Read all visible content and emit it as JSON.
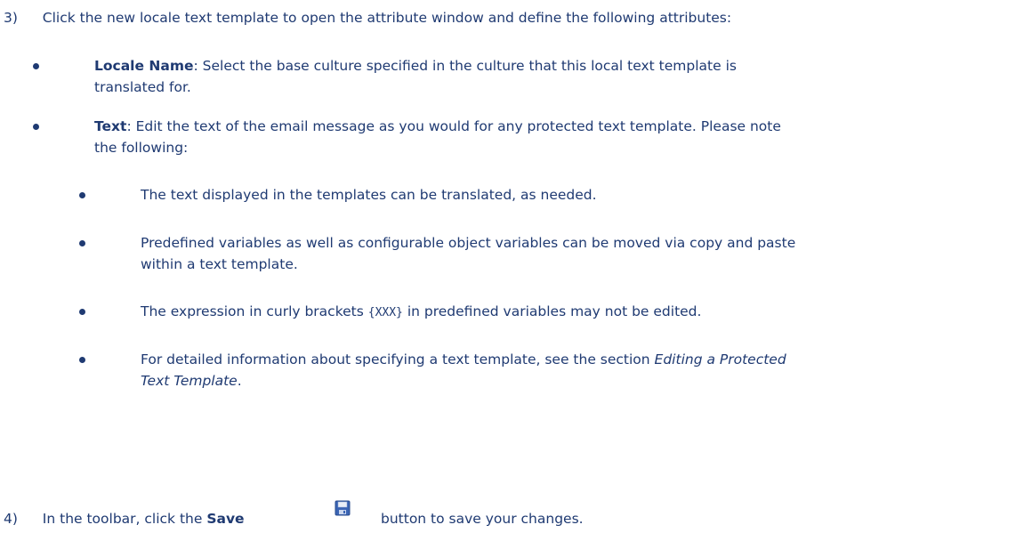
{
  "step3": {
    "number": "3)",
    "text": "Click the new locale text template to open the attribute window and define the following attributes:"
  },
  "locale_name": {
    "term": "Locale Name",
    "sep": ":",
    "line1": " Select the base culture specified in the culture that this local text template is",
    "line2": "translated for."
  },
  "text_attr": {
    "term": "Text",
    "sep": ":",
    "line1": " Edit the text of the email message as you would for any protected text template. Please note",
    "line2": "the following:"
  },
  "notes": {
    "n1": "The text displayed in the templates can be translated, as needed.",
    "n2_line1": "Predefined variables as well as configurable object variables can be moved via copy and paste",
    "n2_line2": "within a text template.",
    "n3_pre": "The expression in curly brackets ",
    "n3_code": "{XXX}",
    "n3_post": " in predefined variables may not be edited.",
    "n4_line1_pre": "For detailed information about specifying a text template, see the section ",
    "n4_line1_em": "Editing a Protected",
    "n4_line2_em": "Text Template",
    "n4_line2_post": "."
  },
  "step4": {
    "number": "4)",
    "pre": "In the toolbar, click the ",
    "save_label": "Save",
    "post": "button to save your changes.",
    "icon": "floppy-disk-save-icon"
  }
}
